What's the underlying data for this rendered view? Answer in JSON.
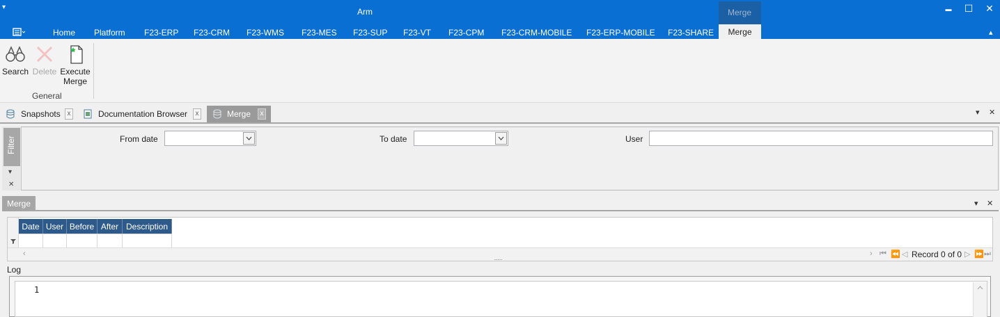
{
  "app": {
    "title": "Arm",
    "context_group": "Merge",
    "quick_access_glyph": "▾",
    "app_menu_icon": "app-menu-icon"
  },
  "window_controls": {
    "minimize": "▬",
    "maximize": "☐",
    "close": "✕",
    "ribbon_collapse": "▴"
  },
  "ribbon_tabs": [
    "Home",
    "Platform",
    "F23-ERP",
    "F23-CRM",
    "F23-WMS",
    "F23-MES",
    "F23-SUP",
    "F23-VT",
    "F23-CPM",
    "F23-CRM-MOBILE",
    "F23-ERP-MOBILE",
    "F23-SHARE"
  ],
  "active_ribbon_tab": "Merge",
  "ribbon": {
    "search_label": "Search",
    "delete_label": "Delete",
    "execute_label_1": "Execute",
    "execute_label_2": "Merge",
    "group_label": "General"
  },
  "doc_tabs": [
    {
      "label": "Snapshots",
      "icon": "database-icon"
    },
    {
      "label": "Documentation Browser",
      "icon": "document-icon"
    },
    {
      "label": "Merge",
      "icon": "database-icon",
      "active": true
    }
  ],
  "doc_tab_close": "x",
  "panel_menu": "▾",
  "panel_close": "✕",
  "filter": {
    "side_label": "Filter",
    "side_collapse": "▾",
    "side_close": "✕",
    "from_date_label": "From date",
    "from_date_value": "",
    "to_date_label": "To date",
    "to_date_value": "",
    "user_label": "User",
    "user_value": ""
  },
  "merge_panel": {
    "tab_label": "Merge",
    "columns": [
      "Date",
      "User",
      "Before",
      "After",
      "Description"
    ],
    "filter_row_icon": "filter-icon",
    "record_text": "Record 0 of 0",
    "resize_grip": "·······"
  },
  "log": {
    "label": "Log",
    "line_number": "1",
    "content": ""
  },
  "colors": {
    "titlebar": "#0a6fd3",
    "context_group": "#1b5fa5",
    "grid_header": "#2d5a8b",
    "active_tab": "#9a9a9a"
  }
}
